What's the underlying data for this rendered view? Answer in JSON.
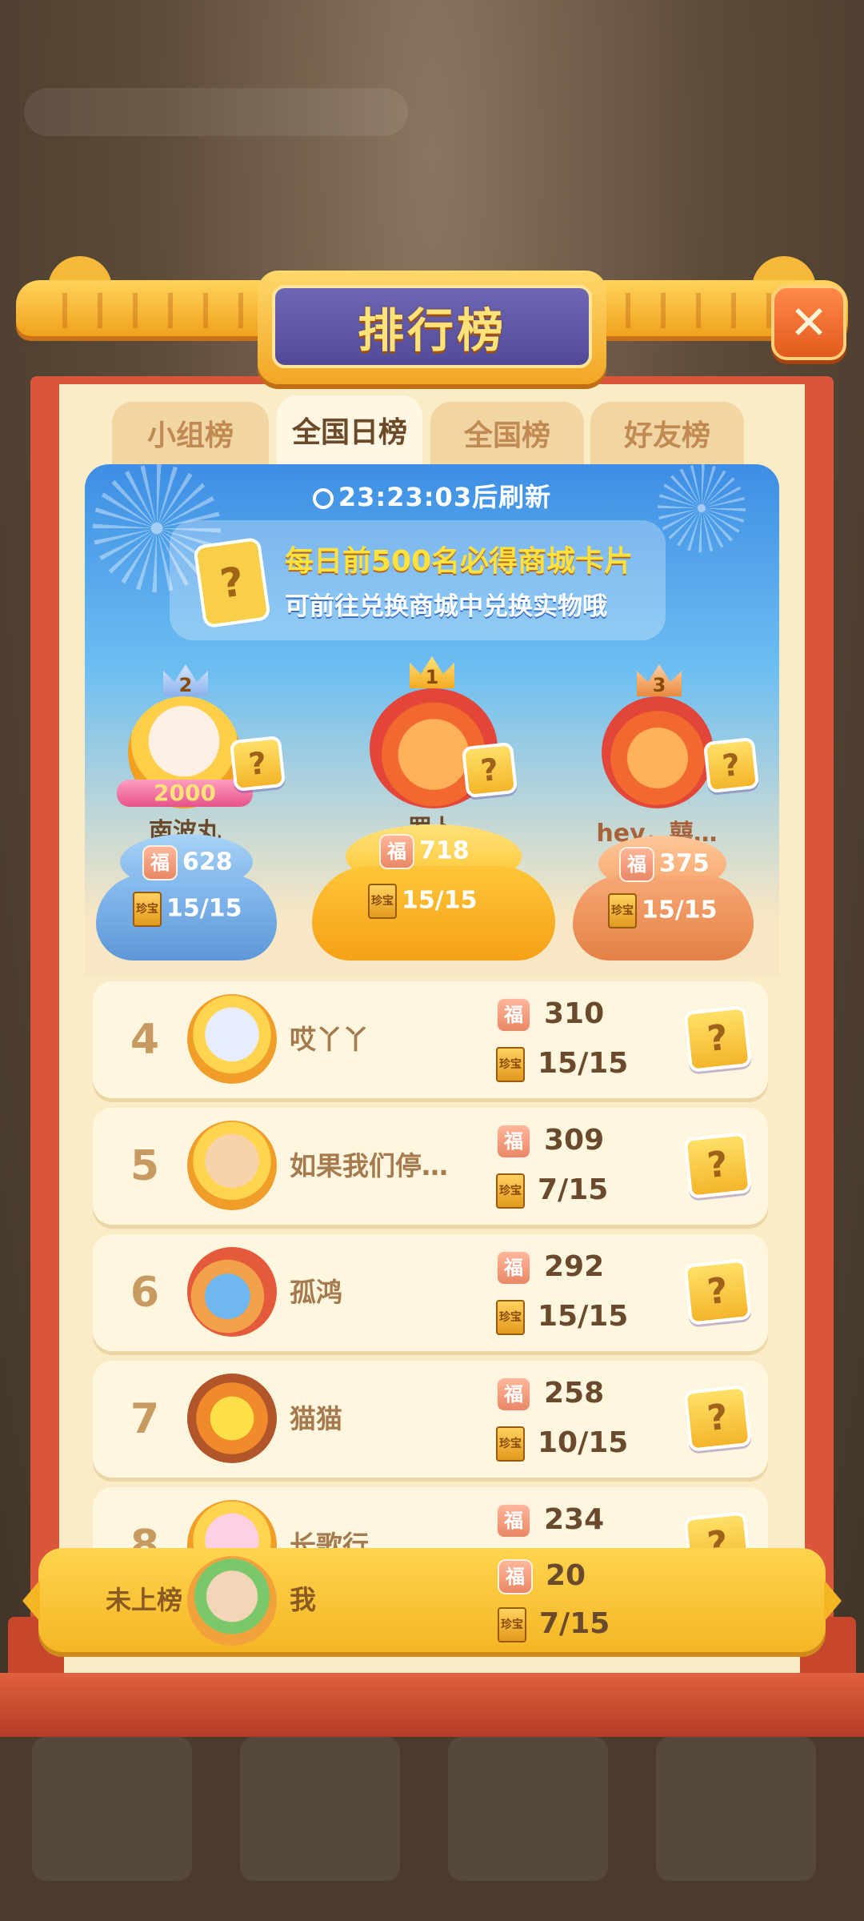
{
  "header": {
    "title": "排行榜",
    "close_symbol": "✕"
  },
  "tabs": [
    {
      "label": "小组榜",
      "active": false
    },
    {
      "label": "全国日榜",
      "active": true
    },
    {
      "label": "全国榜",
      "active": false
    },
    {
      "label": "好友榜",
      "active": false
    }
  ],
  "banner": {
    "timer": "23:23:03后刷新",
    "line1": "每日前500名必得商城卡片",
    "line2": "可前往兑换商城中兑换实物哦",
    "card_symbol": "?"
  },
  "podium": [
    {
      "rank": "1",
      "name": "罗卜",
      "score": "718",
      "cards": "15/15"
    },
    {
      "rank": "2",
      "name": "南波丸",
      "score": "628",
      "cards": "15/15",
      "badge": "2000"
    },
    {
      "rank": "3",
      "name": "hey，囍…",
      "score": "375",
      "cards": "15/15"
    }
  ],
  "rows": [
    {
      "rank": "4",
      "name": "哎丫丫",
      "score": "310",
      "cards": "15/15"
    },
    {
      "rank": "5",
      "name": "如果我们停…",
      "score": "309",
      "cards": "7/15"
    },
    {
      "rank": "6",
      "name": "孤鸿",
      "score": "292",
      "cards": "15/15"
    },
    {
      "rank": "7",
      "name": "猫猫",
      "score": "258",
      "cards": "10/15"
    },
    {
      "rank": "8",
      "name": "长歌行",
      "score": "234",
      "cards": ""
    }
  ],
  "me": {
    "rank_label": "未上榜",
    "name": "我",
    "score": "20",
    "cards": "7/15"
  },
  "icons": {
    "fu": "福",
    "book": "珍宝",
    "question": "?"
  },
  "colors": {
    "accent_gold": "#f4b625",
    "frame_red": "#d9563a",
    "panel_blue": "#3d8ee4"
  }
}
